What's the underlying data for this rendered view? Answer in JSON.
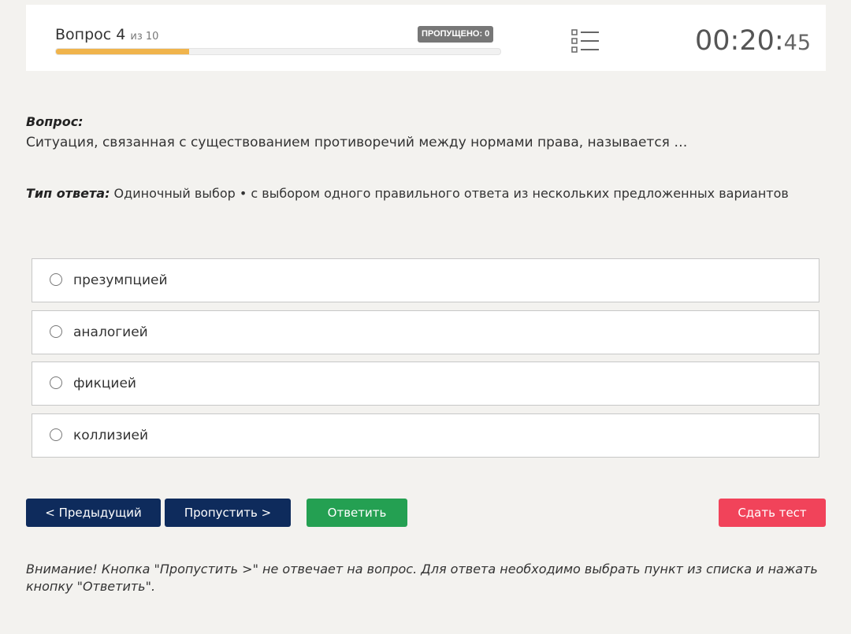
{
  "header": {
    "question_word": "Вопрос",
    "question_number": "4",
    "question_of": "из 10",
    "skipped_badge": "ПРОПУЩЕНО: 0",
    "progress_fraction": 0.3,
    "timer_main": "00:20:",
    "timer_seconds": "45",
    "list_icon": "question-list-icon"
  },
  "question": {
    "label": "Вопрос:",
    "text": "Ситуация, связанная с существованием противоречий между нормами права, называется …"
  },
  "answer_type": {
    "label": "Тип ответа:",
    "value": " Одиночный выбор • с выбором одного правильного ответа из нескольких предложенных вариантов"
  },
  "options": [
    {
      "label": "презумпцией",
      "selected": false
    },
    {
      "label": "аналогией",
      "selected": false
    },
    {
      "label": "фикцией",
      "selected": false
    },
    {
      "label": "коллизией",
      "selected": false
    }
  ],
  "buttons": {
    "prev": "< Предыдущий",
    "skip": "Пропустить >",
    "answer": "Ответить",
    "finish": "Сдать тест"
  },
  "notice": "Внимание! Кнопка \"Пропустить >\" не отвечает на вопрос. Для ответа необходимо выбрать пункт из списка и нажать кнопку \"Ответить\".",
  "colors": {
    "background": "#f3f2ef",
    "progress": "#f0b44c",
    "nav_button": "#0e2b5c",
    "answer_button": "#24a052",
    "finish_button": "#f1435a",
    "badge": "#777777"
  }
}
